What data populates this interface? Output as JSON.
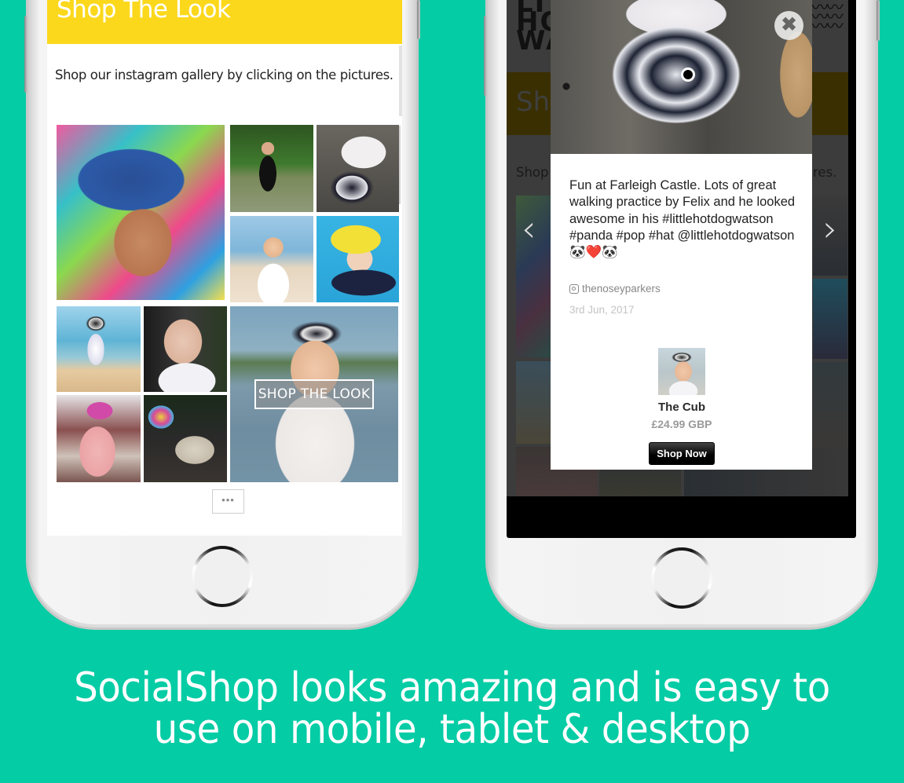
{
  "left_phone": {
    "header_title": "Shop The Look",
    "intro_text": "Shop our instagram gallery by clicking on the pictures.",
    "gallery": {
      "overlay_button_label": "SHOP THE LOOK",
      "load_more_label": "•••"
    }
  },
  "right_phone": {
    "background_page": {
      "logo_lines": [
        "LIT",
        "HOT",
        "WAT"
      ],
      "banner_title_fragment": "Sho",
      "intro_left_fragment": "Shop",
      "intro_right_fragment": "res."
    },
    "navigation": {
      "prev_label": "‹",
      "next_label": "›"
    },
    "modal": {
      "close_label": "✖",
      "caption": "Fun at Farleigh Castle. Lots of great walking practice by Felix and he looked awesome in his #littlehotdogwatson #panda #pop #hat @littlehotdogwatson 🐼❤️🐼",
      "author": "thenoseyparkers",
      "date": "3rd Jun, 2017",
      "product": {
        "name": "The Cub",
        "price": "£24.99 GBP",
        "button_label": "Shop Now"
      }
    }
  },
  "tagline": {
    "line1": "SocialShop looks amazing and is easy to",
    "line2": "use on mobile, tablet & desktop"
  },
  "colors": {
    "background": "#04cca5",
    "header_yellow": "#fcd81c",
    "button_dark": "#000000"
  }
}
